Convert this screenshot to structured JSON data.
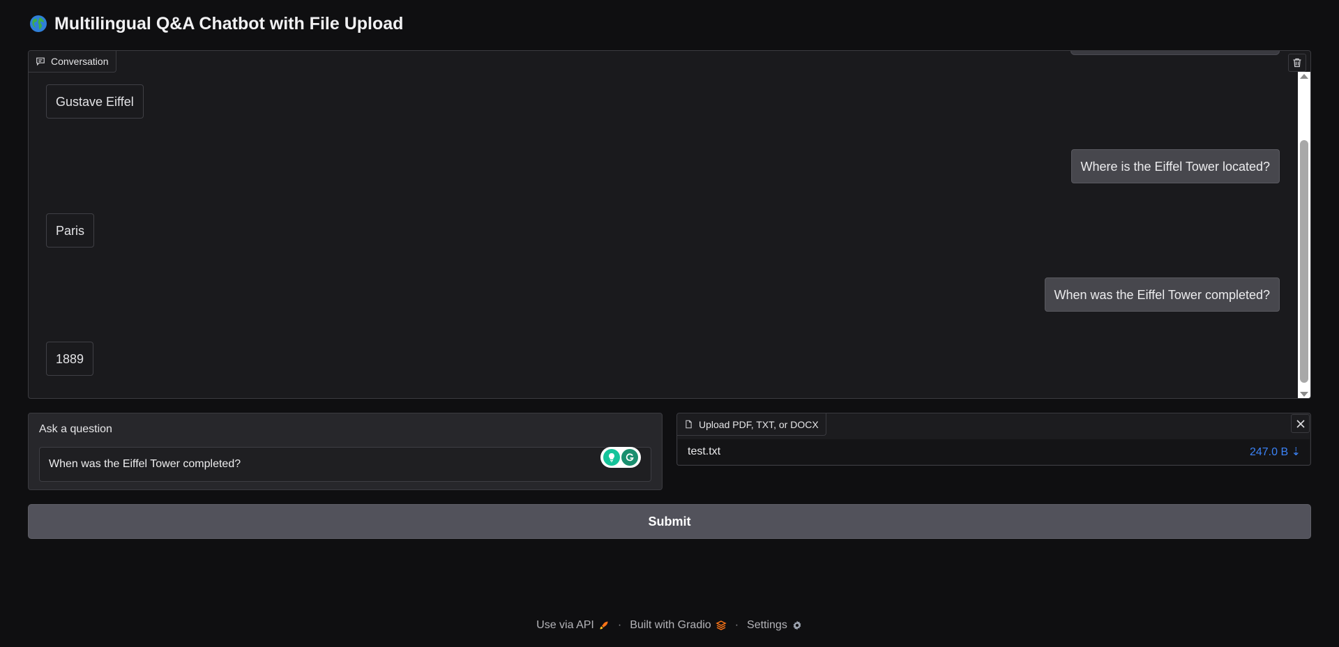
{
  "header": {
    "title": "Multilingual Q&A Chatbot with File Upload",
    "icon": "globe-icon"
  },
  "chatbot": {
    "label": "Conversation",
    "messages": [
      {
        "role": "bot",
        "text": "Gustave Eiffel"
      },
      {
        "role": "user",
        "text": "Where is the Eiffel Tower located?"
      },
      {
        "role": "bot",
        "text": "Paris"
      },
      {
        "role": "user",
        "text": "When was the Eiffel Tower completed?"
      },
      {
        "role": "bot",
        "text": "1889"
      }
    ]
  },
  "question": {
    "label": "Ask a question",
    "value": "When was the Eiffel Tower completed?"
  },
  "file_upload": {
    "label": "Upload PDF, TXT, or DOCX",
    "file_name": "test.txt",
    "file_size": "247.0 B ⇣"
  },
  "submit": {
    "label": "Submit"
  },
  "footer": {
    "api": "Use via API",
    "separator": "·",
    "built": "Built with Gradio",
    "settings": "Settings"
  },
  "colors": {
    "accent_link": "#3b82f6",
    "button": "#52525b",
    "background": "#0f0f11"
  }
}
